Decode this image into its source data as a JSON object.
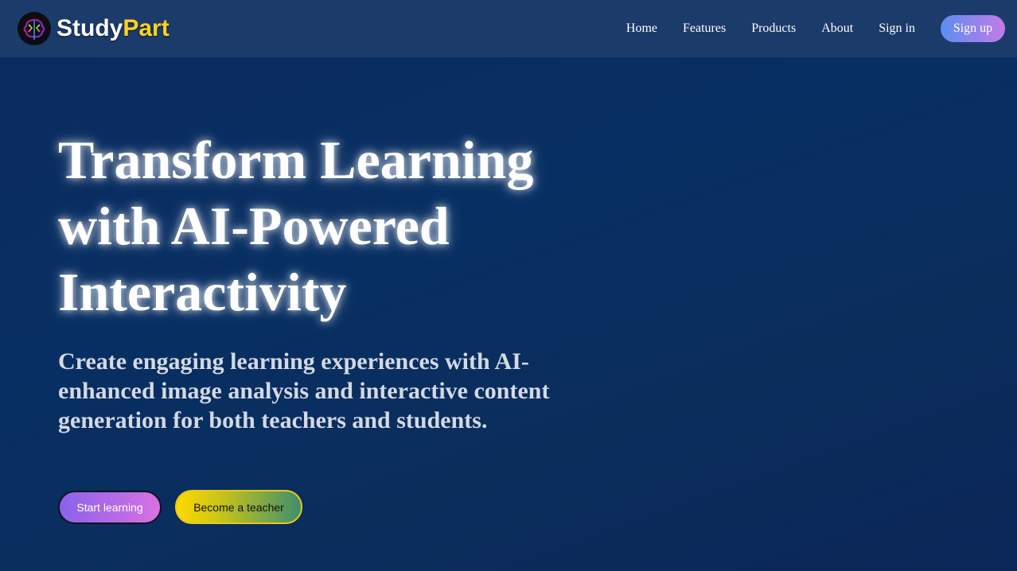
{
  "brand": {
    "name_part1": "Study",
    "name_part2": "Part",
    "logo_icon": "brain-icon",
    "colors": {
      "primary_text": "#ffffff",
      "accent_text": "#ffd21f"
    }
  },
  "nav": {
    "links": [
      "Home",
      "Features",
      "Products",
      "About",
      "Sign in"
    ],
    "signup_label": "Sign up"
  },
  "hero": {
    "title": "Transform Learning with AI-Powered Interactivity",
    "subtitle": "Create engaging learning experiences with AI-enhanced image analysis and interactive content generation for both teachers and students.",
    "primary_cta": "Start learning",
    "secondary_cta": "Become a teacher"
  },
  "colors": {
    "background": "#0b2a5e",
    "navbar": "#1b3b6b",
    "signup_gradient": [
      "#5b8ef0",
      "#c47ae8"
    ],
    "start_gradient": [
      "#8a62ea",
      "#d771e2"
    ],
    "teacher_gradient": [
      "#ffd800",
      "#3f8f6b"
    ]
  }
}
